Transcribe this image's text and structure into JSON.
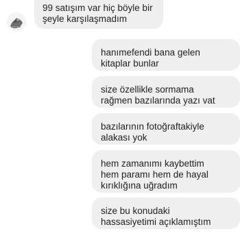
{
  "conversation": {
    "incoming": [
      {
        "text": "99 satışım var hiç böyle bir\nşeyle karşılaşmadım"
      }
    ],
    "outgoing": [
      {
        "text": "hanımefendi bana gelen\nkitaplar bunlar"
      },
      {
        "text": "size özellikle sormama\nrağmen bazılarında yazı vat"
      },
      {
        "text": "bazılarının fotoğraftakiyle\nalakası yok"
      },
      {
        "text": "hem zamanımı kaybettim\nhem paramı hem de hayal\nkırıklığına uğradım"
      },
      {
        "text": "size bu konudaki\nhassasiyetimi açıklamıştım"
      }
    ]
  },
  "avatar_icon": "profile-photo-icon",
  "colors": {
    "bubble": "#efefef",
    "text": "#1f1f1f",
    "background": "#ffffff"
  }
}
